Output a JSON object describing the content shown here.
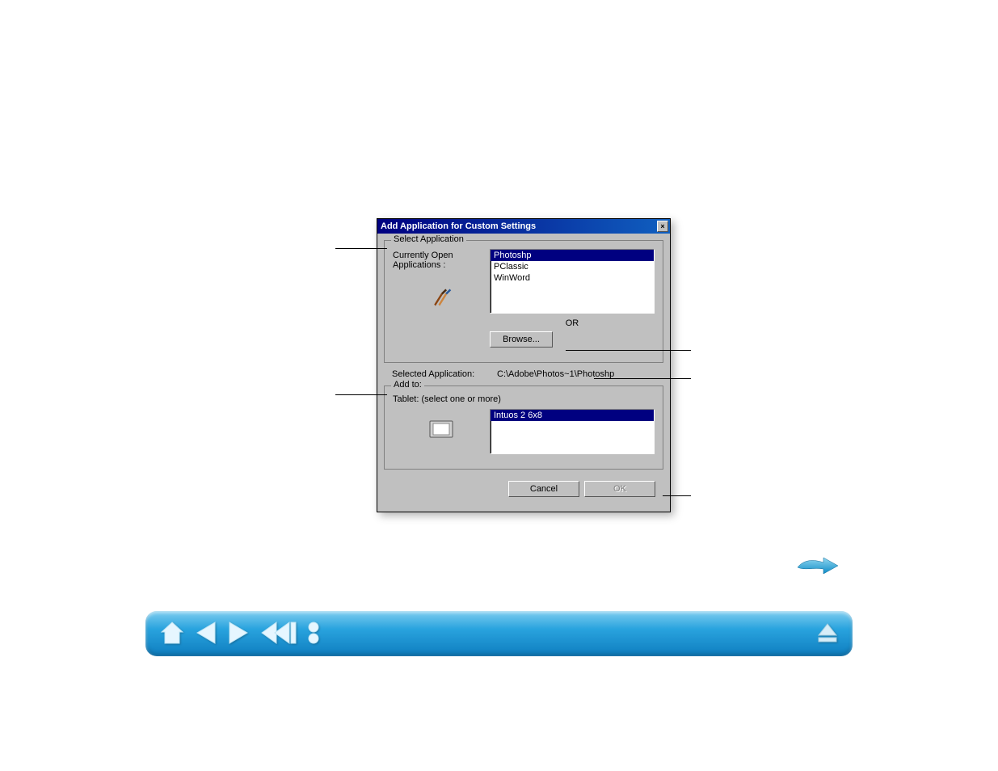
{
  "dialog": {
    "title": "Add Application for Custom Settings",
    "close_label": "×",
    "group_select": {
      "legend": "Select Application",
      "current_open_label": "Currently Open Applications :",
      "items": [
        "Photoshp",
        "PClassic",
        "WinWord"
      ],
      "selected_index": 0,
      "or_label": "OR",
      "browse_label": "Browse..."
    },
    "selected_app": {
      "label": "Selected Application:",
      "path": "C:\\Adobe\\Photos~1\\Photoshp"
    },
    "group_add": {
      "legend": "Add to:",
      "tablet_label": "Tablet: (select one or more)",
      "items": [
        "Intuos 2 6x8"
      ],
      "selected_index": 0
    },
    "buttons": {
      "cancel": "Cancel",
      "ok": "OK"
    }
  },
  "nav": {
    "home": "home",
    "prev": "prev",
    "next": "next",
    "back_multi": "back-multi",
    "toc": "contents",
    "eject": "eject"
  }
}
